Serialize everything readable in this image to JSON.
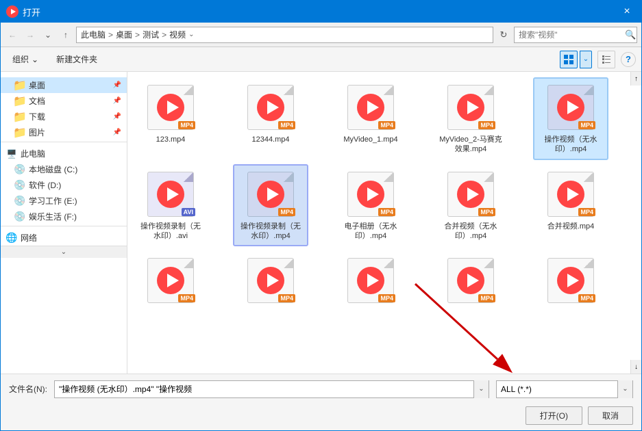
{
  "window": {
    "title": "打开",
    "close_label": "×"
  },
  "address": {
    "back_title": "后退",
    "forward_title": "前进",
    "up_title": "上一级",
    "path_parts": [
      "此电脑",
      "桌面",
      "测试",
      "视频"
    ],
    "refresh_title": "刷新",
    "search_placeholder": "搜索\"视频\"",
    "search_icon": "🔍"
  },
  "toolbar": {
    "organize_label": "组织",
    "new_folder_label": "新建文件夹",
    "help_label": "?"
  },
  "sidebar": {
    "items": [
      {
        "id": "desktop",
        "label": "桌面",
        "indent": 1,
        "selected": true,
        "pin": true
      },
      {
        "id": "docs",
        "label": "文档",
        "indent": 1,
        "selected": false,
        "pin": true
      },
      {
        "id": "downloads",
        "label": "下载",
        "indent": 1,
        "selected": false,
        "pin": true
      },
      {
        "id": "pictures",
        "label": "图片",
        "indent": 1,
        "selected": false,
        "pin": true
      },
      {
        "id": "mypc",
        "label": "此电脑",
        "indent": 0,
        "selected": false,
        "pin": false
      },
      {
        "id": "cdrive",
        "label": "本地磁盘 (C:)",
        "indent": 1,
        "selected": false,
        "pin": false
      },
      {
        "id": "ddrive",
        "label": "软件 (D:)",
        "indent": 1,
        "selected": false,
        "pin": false
      },
      {
        "id": "edrive",
        "label": "学习工作 (E:)",
        "indent": 1,
        "selected": false,
        "pin": false
      },
      {
        "id": "fdrive",
        "label": "娱乐生活 (F:)",
        "indent": 1,
        "selected": false,
        "pin": false
      },
      {
        "id": "network",
        "label": "网络",
        "indent": 0,
        "selected": false,
        "pin": false
      }
    ]
  },
  "files": [
    {
      "id": "f1",
      "name": "123.mp4",
      "badge": "MP4",
      "selected": false
    },
    {
      "id": "f2",
      "name": "12344.mp4",
      "badge": "MP4",
      "selected": false
    },
    {
      "id": "f3",
      "name": "MyVideo_1.mp4",
      "badge": "MP4",
      "selected": false
    },
    {
      "id": "f4",
      "name": "MyVideo_2-马赛克效果.mp4",
      "badge": "MP4",
      "selected": false
    },
    {
      "id": "f5",
      "name": "操作视频（无水印）.mp4",
      "badge": "MP4",
      "selected": true
    },
    {
      "id": "f6",
      "name": "操作视频录制（无水印）.avi",
      "badge": "AVI",
      "selected": false
    },
    {
      "id": "f7",
      "name": "操作视频录制（无水印）.mp4",
      "badge": "MP4",
      "selected": true
    },
    {
      "id": "f8",
      "name": "电子相册（无水印）.mp4",
      "badge": "MP4",
      "selected": false
    },
    {
      "id": "f9",
      "name": "合并视频（无水印）.mp4",
      "badge": "MP4",
      "selected": false
    },
    {
      "id": "f10",
      "name": "合并视频.mp4",
      "badge": "MP4",
      "selected": false
    },
    {
      "id": "f11",
      "name": "",
      "badge": "MP4",
      "selected": false
    },
    {
      "id": "f12",
      "name": "",
      "badge": "MP4",
      "selected": false
    },
    {
      "id": "f13",
      "name": "",
      "badge": "MP4",
      "selected": false
    },
    {
      "id": "f14",
      "name": "",
      "badge": "MP4",
      "selected": false
    },
    {
      "id": "f15",
      "name": "",
      "badge": "MP4",
      "selected": false
    }
  ],
  "bottom": {
    "filename_label": "文件名(N):",
    "filename_value": "\"操作视频 (无水印）.mp4\" \"操作视频",
    "filetype_label": "ALL (*.*)",
    "open_label": "打开(O)",
    "cancel_label": "取消"
  }
}
